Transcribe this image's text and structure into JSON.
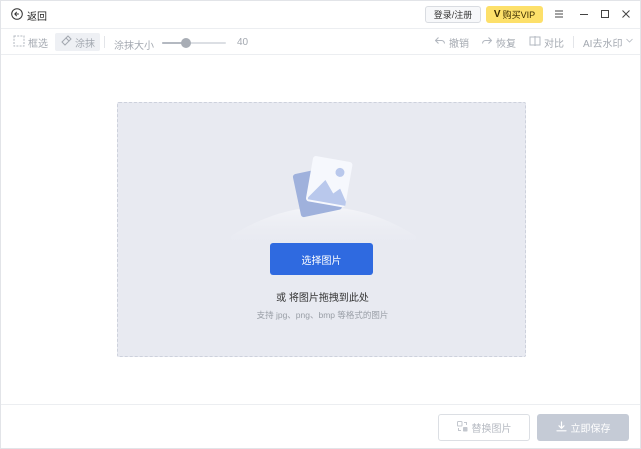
{
  "titlebar": {
    "back_label": "返回",
    "login_label": "登录/注册",
    "vip_logo": "V",
    "vip_label": "购买VIP"
  },
  "toolbar": {
    "box_select_label": "框选",
    "brush_label": "涂抹",
    "brush_size_label": "涂抹大小",
    "brush_size_value": "40",
    "brush_size_fraction": 0.38,
    "undo_label": "撤销",
    "redo_label": "恢复",
    "compare_label": "对比",
    "ai_mode_label": "AI去水印"
  },
  "dropzone": {
    "choose_label": "选择图片",
    "drag_hint": "或 将图片拖拽到此处",
    "support_hint": "支持 jpg、png、bmp 等格式的图片"
  },
  "footer": {
    "replace_label": "替换图片",
    "save_label": "立即保存"
  },
  "colors": {
    "primary": "#2f6ae0",
    "vip": "#fde06a",
    "disabled": "#c5cbd6",
    "dropzone_bg": "#e8eaf1"
  }
}
